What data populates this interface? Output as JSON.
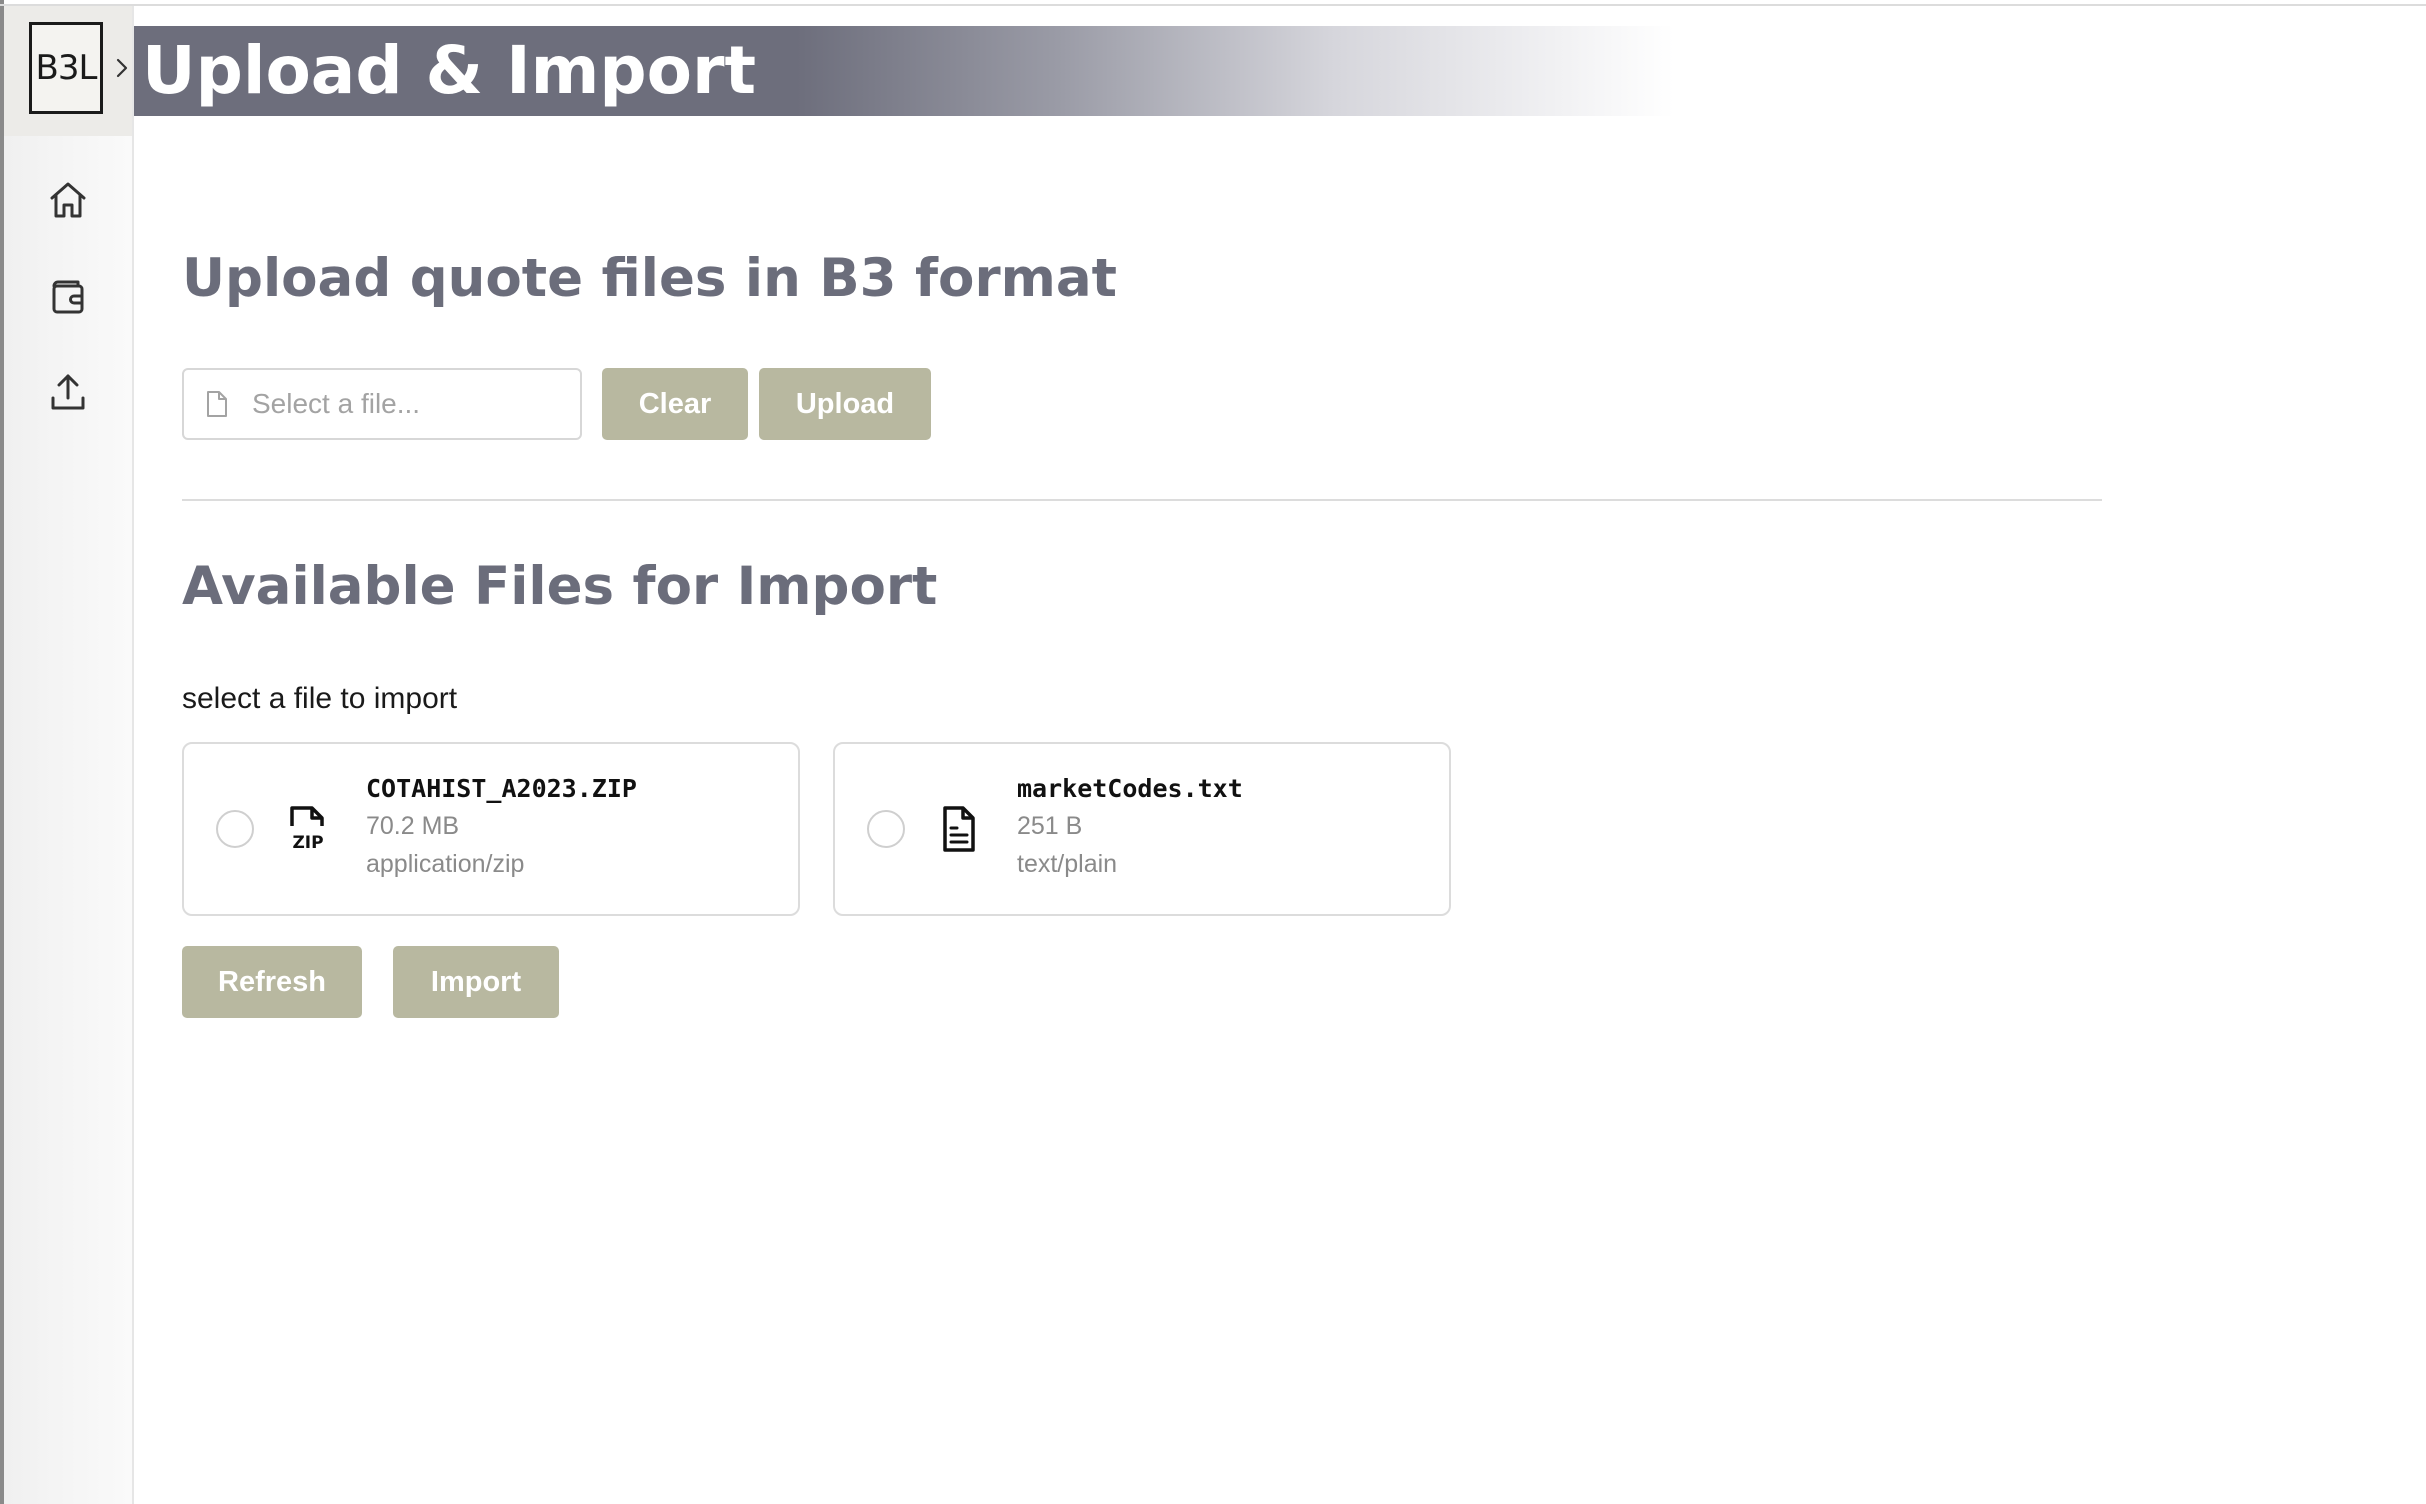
{
  "app": {
    "logo_text": "B3L",
    "title": "Upload & Import"
  },
  "sidebar": {
    "items": [
      {
        "icon": "home-icon"
      },
      {
        "icon": "wallet-icon"
      },
      {
        "icon": "upload-icon"
      }
    ]
  },
  "upload_section": {
    "heading": "Upload quote files in B3 format",
    "file_input_placeholder": "Select a file...",
    "clear_label": "Clear",
    "upload_label": "Upload"
  },
  "import_section": {
    "heading": "Available Files for Import",
    "instruction": "select a file to import",
    "files": [
      {
        "name": "COTAHIST_A2023.ZIP",
        "size": "70.2 MB",
        "mime": "application/zip",
        "icon": "zip-file-icon",
        "selected": false
      },
      {
        "name": "marketCodes.txt",
        "size": "251 B",
        "mime": "text/plain",
        "icon": "text-file-icon",
        "selected": false
      }
    ],
    "refresh_label": "Refresh",
    "import_label": "Import"
  },
  "colors": {
    "header_band": "#6d6e7c",
    "heading_text": "#6b6d7b",
    "button_bg": "#b8b8a0",
    "button_text": "#ffffff"
  }
}
